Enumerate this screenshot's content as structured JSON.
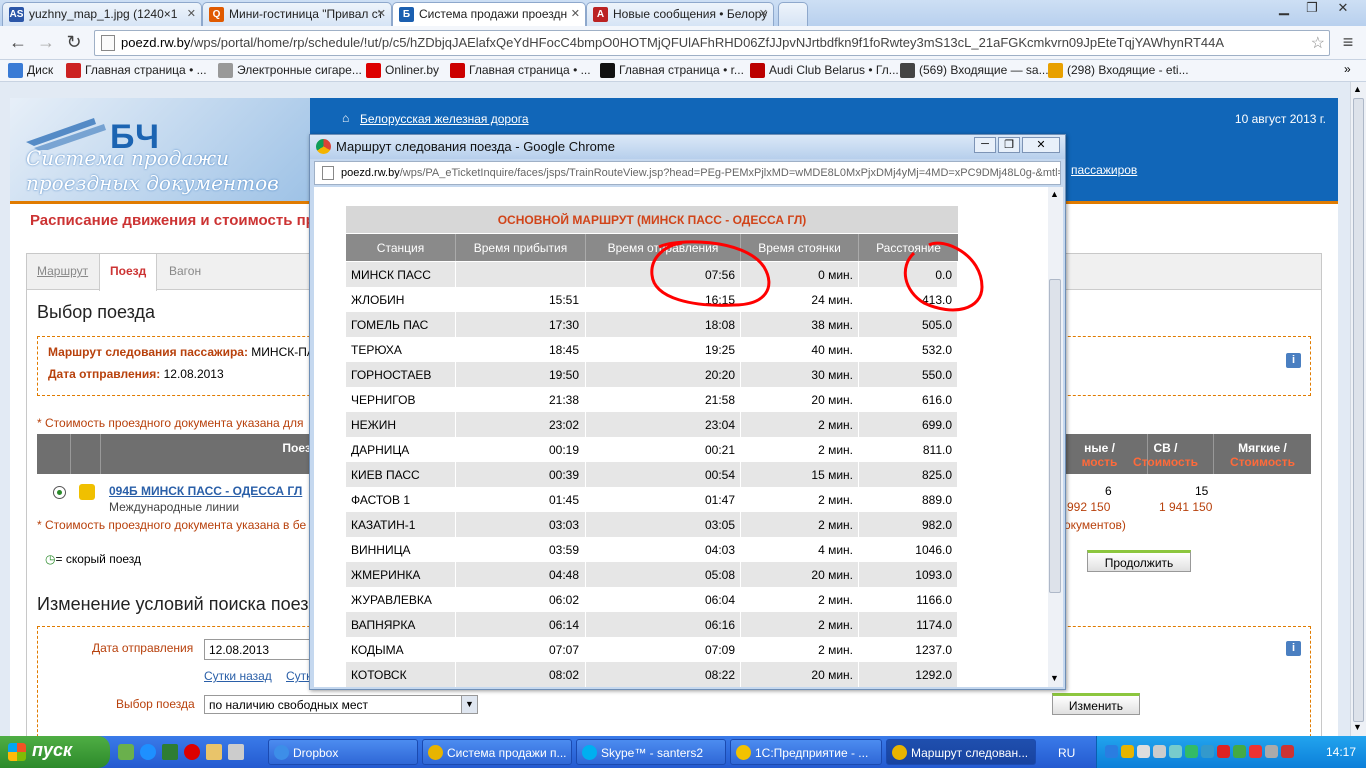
{
  "browser": {
    "tabs": [
      {
        "label": "yuzhny_map_1.jpg (1240×1",
        "icon": "AS",
        "color": "#2b56a8"
      },
      {
        "label": "Мини-гостиница \"Привал ст",
        "icon": "Q",
        "color": "#e05a00"
      },
      {
        "label": "Система продажи проездн",
        "icon": "Б",
        "color": "#1b5fb0"
      },
      {
        "label": "Новые сообщения • Белору",
        "icon": "A",
        "color": "#b22"
      }
    ],
    "url_host": "poezd.rw.by",
    "url_path": "/wps/portal/home/rp/schedule/!ut/p/c5/hZDbjqJAElafxQeYdHFocC4bmpO0HOTMjQFUlAFhRHD06ZfJJpvNJrtbdfkn9f1foRwtey3mS13cL_21aFGKcmkvrn09JpEteTqjYAWhynRT44A",
    "bookmarks": [
      {
        "label": "Диск",
        "color": "#3a7bd5"
      },
      {
        "label": "Главная страница • ...",
        "color": "#c22"
      },
      {
        "label": "Электронные сигаре...",
        "color": "#999"
      },
      {
        "label": "Onliner.by",
        "color": "#d00"
      },
      {
        "label": "Главная страница • ...",
        "color": "#c00"
      },
      {
        "label": "Главная страница • r...",
        "color": "#111"
      },
      {
        "label": "Audi Club Belarus • Гл...",
        "color": "#b00"
      },
      {
        "label": "(569) Входящие — sa...",
        "color": "#444"
      },
      {
        "label": "(298) Входящие - eti...",
        "color": "#e8a000"
      }
    ]
  },
  "site": {
    "logo_mark": "БЧ",
    "logo_line1": "Система продажи",
    "logo_line2": "проездных документов",
    "home_link": "Белорусская железная дорога",
    "date": "10 август 2013 г.",
    "passengers_link": "пассажиров",
    "section_title": "Расписание движения и стоимость про",
    "tabs": [
      "Маршрут",
      "Поезд",
      "Вагон"
    ],
    "choose_heading": "Выбор поезда",
    "route_label": "Маршрут следования пассажира:",
    "route_value": "МИНСК-ПА",
    "date_label": "Дата отправления:",
    "date_value": "12.08.2013",
    "price_note": "* Стоимость проездного документа указана для",
    "col_train": "Поезд",
    "col_compartment": "ные /",
    "col_compartment_sub": "мость",
    "col_sv": "СВ /",
    "col_sv_sub": "Стоимость",
    "col_soft": "Мягкие /",
    "col_soft_sub": "Стоимость",
    "train_link": "094Б МИНСК ПАСС - ОДЕССА ГЛ",
    "train_type": "Международные линии",
    "seats_compartment": "6",
    "seats_sv": "15",
    "price_compartment": "992 150",
    "price_sv": "1 941 150",
    "price_note2": "* Стоимость проездного документа указана в бе",
    "price_note2_end": "документов)",
    "fast_legend": "= скорый поезд",
    "continue_btn": "Продолжить",
    "change_heading": "Изменение условий поиска поез",
    "dep_date_label": "Дата отправления",
    "dep_date_value": "12.08.2013",
    "day_back": "Сутки назад",
    "day_fwd": "Сутк",
    "select_label": "Выбор поезда",
    "select_value": "по наличию свободных мест",
    "change_btn": "Изменить"
  },
  "popup": {
    "title": "Маршрут следования поезда - Google Chrome",
    "url_host": "poezd.rw.by",
    "url_path": "/wps/PA_eTicketInquire/faces/jsps/TrainRouteView.jsp?head=PEg-PEMxPjlxMD=wMDE8L0MxPjxDMj4yMj=4MD=xPC9DMj48L0g-&mtl=PEx",
    "route_title": "ОСНОВНОЙ МАРШРУТ (МИНСК ПАСС - ОДЕССА ГЛ)",
    "columns": [
      "Станция",
      "Время прибытия",
      "Время отправления",
      "Время стоянки",
      "Расстояние"
    ],
    "rows": [
      [
        "МИНСК ПАСС",
        "",
        "07:56",
        "0 мин.",
        "0.0"
      ],
      [
        "ЖЛОБИН",
        "15:51",
        "16:15",
        "24 мин.",
        "413.0"
      ],
      [
        "ГОМЕЛЬ ПАС",
        "17:30",
        "18:08",
        "38 мин.",
        "505.0"
      ],
      [
        "ТЕРЮХА",
        "18:45",
        "19:25",
        "40 мин.",
        "532.0"
      ],
      [
        "ГОРНОСТАЕВ",
        "19:50",
        "20:20",
        "30 мин.",
        "550.0"
      ],
      [
        "ЧЕРНИГОВ",
        "21:38",
        "21:58",
        "20 мин.",
        "616.0"
      ],
      [
        "НЕЖИН",
        "23:02",
        "23:04",
        "2 мин.",
        "699.0"
      ],
      [
        "ДАРНИЦА",
        "00:19",
        "00:21",
        "2 мин.",
        "811.0"
      ],
      [
        "КИЕВ ПАСС",
        "00:39",
        "00:54",
        "15 мин.",
        "825.0"
      ],
      [
        "ФАСТОВ 1",
        "01:45",
        "01:47",
        "2 мин.",
        "889.0"
      ],
      [
        "КАЗАТИН-1",
        "03:03",
        "03:05",
        "2 мин.",
        "982.0"
      ],
      [
        "ВИННИЦА",
        "03:59",
        "04:03",
        "4 мин.",
        "1046.0"
      ],
      [
        "ЖМЕРИНКА",
        "04:48",
        "05:08",
        "20 мин.",
        "1093.0"
      ],
      [
        "ЖУРАВЛЕВКА",
        "06:02",
        "06:04",
        "2 мин.",
        "1166.0"
      ],
      [
        "ВАПНЯРКА",
        "06:14",
        "06:16",
        "2 мин.",
        "1174.0"
      ],
      [
        "КОДЫМА",
        "07:07",
        "07:09",
        "2 мин.",
        "1237.0"
      ],
      [
        "КОТОВСК",
        "08:02",
        "08:22",
        "20 мин.",
        "1292.0"
      ]
    ]
  },
  "taskbar": {
    "start": "пуск",
    "tasks": [
      {
        "label": "Dropbox",
        "color": "#3d8ee8"
      },
      {
        "label": "Система продажи п...",
        "color": "#e8b400"
      },
      {
        "label": "Skype™ - santers2",
        "color": "#00aff0"
      },
      {
        "label": "1С:Предприятие - ...",
        "color": "#f2c200"
      },
      {
        "label": "Маршрут следован...",
        "color": "#e8b400"
      }
    ],
    "lang": "RU",
    "clock": "14:17"
  },
  "colors": {
    "annotation": "#ff0000",
    "accent_orange": "#e07b00",
    "brand_blue": "#1166b8"
  }
}
